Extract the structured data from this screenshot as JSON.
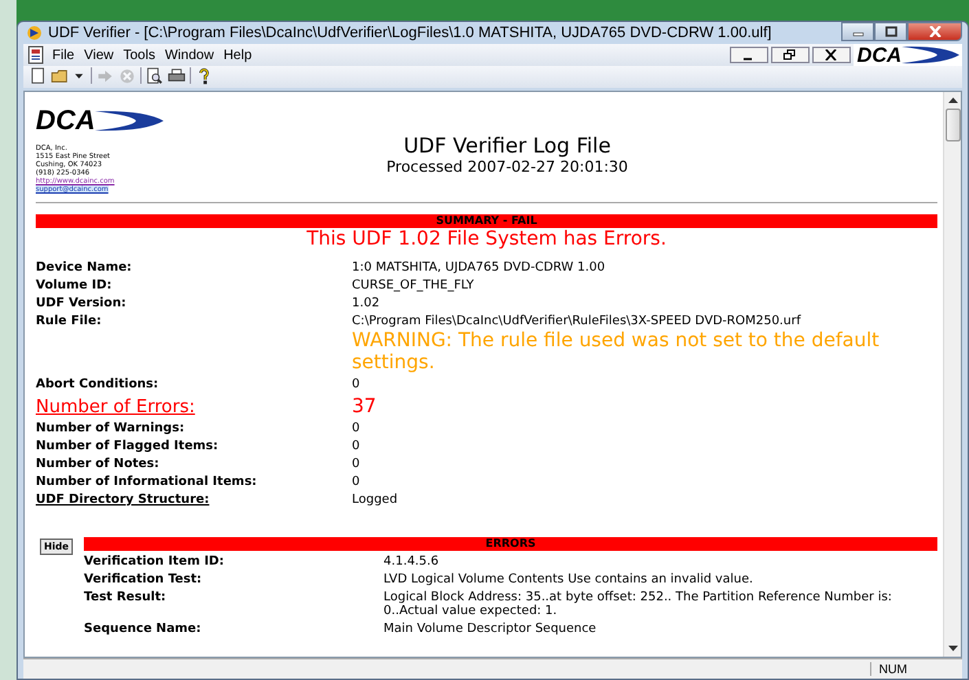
{
  "window": {
    "title": "UDF Verifier - [C:\\Program Files\\DcaInc\\UdfVerifier\\LogFiles\\1.0 MATSHITA, UJDA765 DVD-CDRW 1.00.ulf]"
  },
  "menu": [
    {
      "label": "File"
    },
    {
      "label": "View"
    },
    {
      "label": "Tools"
    },
    {
      "label": "Window"
    },
    {
      "label": "Help"
    }
  ],
  "toolbar": [
    {
      "kind": "new"
    },
    {
      "kind": "open"
    },
    {
      "kind": "dropdown"
    },
    {
      "kind": "sep"
    },
    {
      "kind": "go",
      "disabled": true
    },
    {
      "kind": "stop",
      "disabled": true
    },
    {
      "kind": "sep"
    },
    {
      "kind": "preview"
    },
    {
      "kind": "print"
    },
    {
      "kind": "sep"
    },
    {
      "kind": "help"
    }
  ],
  "header": {
    "logo_text": "DCA",
    "address": [
      "DCA, Inc.",
      "1515 East Pine Street",
      "Cushing, OK 74023",
      "(918) 225-0346"
    ],
    "website": "http://www.dcainc.com",
    "email": "support@dcainc.com",
    "title": "UDF Verifier Log File",
    "processed": "Processed 2007-02-27 20:01:30"
  },
  "mdi_logo": "DCA",
  "summary": {
    "banner": "SUMMARY - FAIL",
    "headline": "This UDF 1.02 File System has Errors.",
    "fields": [
      {
        "label": "Device Name:",
        "value": "1:0 MATSHITA, UJDA765 DVD-CDRW 1.00",
        "kind": "plain"
      },
      {
        "label": "Volume ID:",
        "value": "CURSE_OF_THE_FLY",
        "kind": "plain"
      },
      {
        "label": "UDF Version:",
        "value": "1.02",
        "kind": "plain"
      },
      {
        "label": "Rule File:",
        "value": "C:\\Program Files\\DcaInc\\UdfVerifier\\RuleFiles\\3X-SPEED DVD-ROM250.urf",
        "note": "WARNING: The rule file used was not set to the default settings.",
        "kind": "plain"
      },
      {
        "label": "Abort Conditions:",
        "value": "0",
        "kind": "plain"
      },
      {
        "label": "Number of Errors:",
        "value": "37",
        "kind": "alert"
      },
      {
        "label": "Number of Warnings:",
        "value": "0",
        "kind": "plain"
      },
      {
        "label": "Number of Flagged Items:",
        "value": "0",
        "kind": "plain"
      },
      {
        "label": "Number of Notes:",
        "value": "0",
        "kind": "plain"
      },
      {
        "label": "Number of Informational Items:",
        "value": "0",
        "kind": "plain"
      },
      {
        "label": "UDF Directory Structure:",
        "value": "Logged",
        "kind": "section"
      }
    ]
  },
  "errors": {
    "hide_button": "Hide",
    "banner": "ERRORS",
    "fields": [
      {
        "label": "Verification Item ID:",
        "value": "4.1.4.5.6"
      },
      {
        "label": "Verification Test:",
        "value": "LVD Logical Volume Contents Use contains an invalid value."
      },
      {
        "label": "Test Result:",
        "value": "Logical Block Address: 35..at byte offset: 252.. The Partition Reference Number is: 0..Actual value expected: 1."
      },
      {
        "label": "Sequence Name:",
        "value": "Main Volume Descriptor Sequence"
      }
    ]
  },
  "status_bar": {
    "indicator": "NUM"
  }
}
